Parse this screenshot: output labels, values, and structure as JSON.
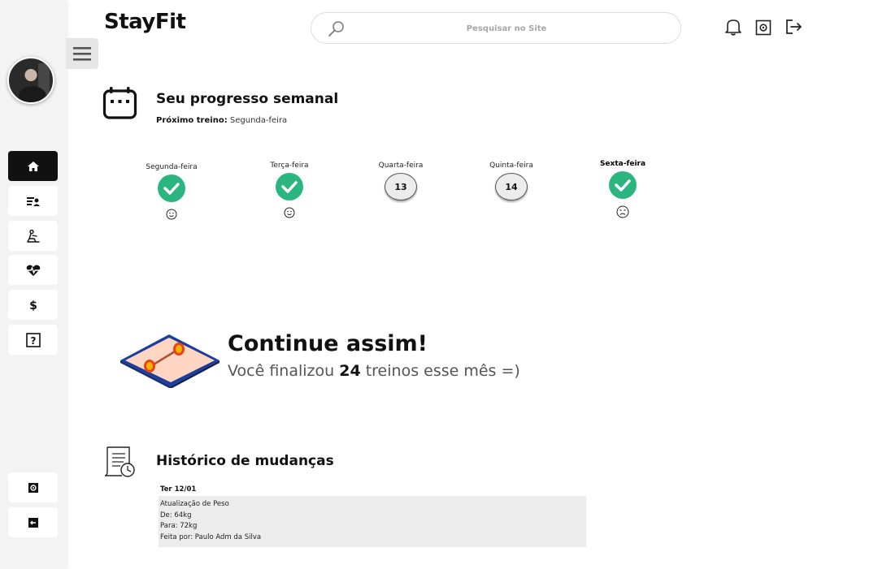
{
  "app": {
    "brand": "StayFit"
  },
  "search": {
    "placeholder": "Pesquisar no Site"
  },
  "sidebar": {
    "items": [
      {
        "name": "home",
        "icon": "home-icon",
        "active": true
      },
      {
        "name": "workout-list",
        "icon": "list-user-icon"
      },
      {
        "name": "exercise",
        "icon": "exercise-icon"
      },
      {
        "name": "health",
        "icon": "heartbeat-icon"
      },
      {
        "name": "payments",
        "icon": "dollar-icon"
      },
      {
        "name": "help",
        "icon": "question-icon"
      }
    ],
    "bottom": [
      {
        "name": "settings",
        "icon": "gear-icon"
      },
      {
        "name": "logout",
        "icon": "logout-icon"
      }
    ]
  },
  "weekly": {
    "title": "Seu progresso semanal",
    "next_label": "Próximo treino:",
    "next_value": " Segunda-feira",
    "days": [
      {
        "label": "Segunda-feira",
        "status": "done",
        "mood": "happy"
      },
      {
        "label": "Terça-feira",
        "status": "done",
        "mood": "happy"
      },
      {
        "label": "Quarta-feira",
        "status": "date",
        "date": "13"
      },
      {
        "label": "Quinta-feira",
        "status": "date",
        "date": "14"
      },
      {
        "label": "Sexta-feira",
        "status": "done",
        "mood": "sad",
        "current": true
      }
    ]
  },
  "motivation": {
    "title": "Continue assim!",
    "text_before": "Você finalizou ",
    "count": "24",
    "text_after": " treinos esse mês =)"
  },
  "history": {
    "title": "Histórico de mudanças",
    "entries": [
      {
        "date": "Ter 12/01",
        "lines": [
          "Atualização de Peso",
          "De: 64kg",
          "Para: 72kg",
          "Feita por: Paulo Adm da Silva"
        ]
      }
    ]
  },
  "colors": {
    "accent": "#2bb57f",
    "dark": "#111111",
    "sidebar": "#f3f3f3"
  }
}
